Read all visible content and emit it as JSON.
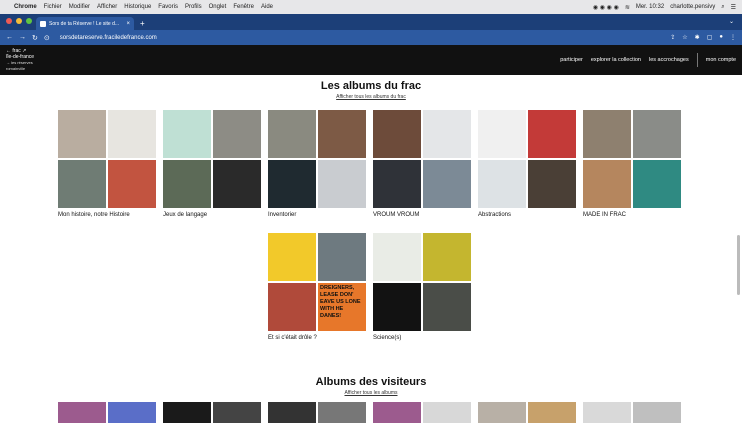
{
  "os_menubar": {
    "app": "Chrome",
    "items": [
      "Fichier",
      "Modifier",
      "Afficher",
      "Historique",
      "Favoris",
      "Profils",
      "Onglet",
      "Fenêtre",
      "Aide"
    ],
    "clock": "Mer. 10:32",
    "user": "charlotte.pensivy"
  },
  "browser": {
    "tab_title": "Sors de ta Réserve ! Le site d...",
    "url": "sorsdetareserve.fraciledefrance.com",
    "colors": {
      "tabbar": "#1c3f78",
      "toolbar": "#2d5aa1"
    }
  },
  "site": {
    "logo": {
      "line1": "frac",
      "line2": "île-de-france",
      "line3": "les réserves",
      "line4": "romainville"
    },
    "nav": [
      "participer",
      "explorer la collection",
      "les accrochages",
      "mon compte"
    ]
  },
  "albums_section": {
    "title": "Les albums du frac",
    "link": "Afficher tous les albums du frac",
    "albums": [
      {
        "label": "Mon histoire, notre Histoire",
        "tiles": [
          "#b9ada0",
          "#e7e5e0",
          "#6f7c74",
          "#c25440"
        ]
      },
      {
        "label": "Jeux de langage",
        "tiles": [
          "#bfe0d4",
          "#8d8c85",
          "#5c6a57",
          "#2a2a2a"
        ]
      },
      {
        "label": "Inventorier",
        "tiles": [
          "#8a8a80",
          "#7d5a45",
          "#1f2a30",
          "#c9ccd0"
        ]
      },
      {
        "label": "VROUM VROUM",
        "tiles": [
          "#6d4b3a",
          "#e4e6e8",
          "#2f3238",
          "#7c8a96"
        ]
      },
      {
        "label": "Abstractions",
        "tiles": [
          "#f0f0f0",
          "#c33a38",
          "#dde2e5",
          "#4a3f36"
        ]
      },
      {
        "label": "MADE IN FRAC",
        "tiles": [
          "#8e806f",
          "#8a8c88",
          "#b5865e",
          "#2f8a82"
        ]
      },
      {
        "label": "Et si c'était drôle ?",
        "tiles": [
          "#f2c92a",
          "#6e7a80",
          "#b04a3a",
          "#e7772a"
        ]
      },
      {
        "label": "Science(s)",
        "tiles": [
          "#e9ece6",
          "#c4b62f",
          "#121212",
          "#4a4d48"
        ]
      }
    ],
    "poster_text": "DREIGNERS, LEASE DON' EAVE US LONE WITH HE DANES!"
  },
  "visitors_section": {
    "title": "Albums des visiteurs",
    "link": "Afficher tous les albums",
    "tiles": [
      [
        "#9c5b8e",
        "#5a6ec8"
      ],
      [
        "#1a1a1a",
        "#444444"
      ],
      [
        "#333333",
        "#777777"
      ],
      [
        "#9c5b8e",
        "#d8d8d8"
      ],
      [
        "#b8b0a6",
        "#c7a16b"
      ],
      [
        "#d9d9d9",
        "#bfbfbf"
      ]
    ]
  }
}
